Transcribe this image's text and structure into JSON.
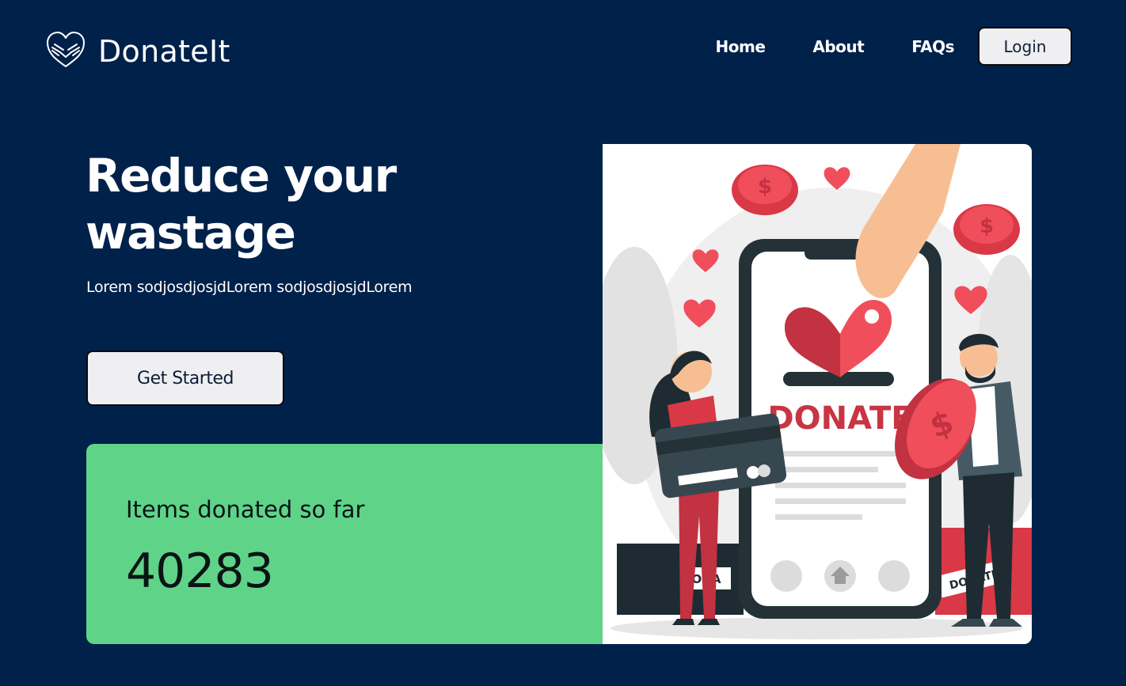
{
  "brand": {
    "name": "DonateIt",
    "logo_icon": "heart-hands-icon"
  },
  "nav": {
    "home": "Home",
    "about": "About",
    "faqs": "FAQs",
    "login": "Login"
  },
  "hero": {
    "title": "Reduce your wastage",
    "subtitle": "Lorem sodjosdjosjdLorem sodjosdjosjdLorem",
    "cta": "Get Started"
  },
  "stats": {
    "label": "Items donated so far",
    "value": "40283"
  },
  "illustration": {
    "phone_text": "DONATE",
    "box_text_left": "ONA",
    "box_text_right": "DONATE",
    "icon": "donation-illustration"
  },
  "colors": {
    "background": "#00214a",
    "card": "#5fd489",
    "accent": "#e8424f"
  }
}
